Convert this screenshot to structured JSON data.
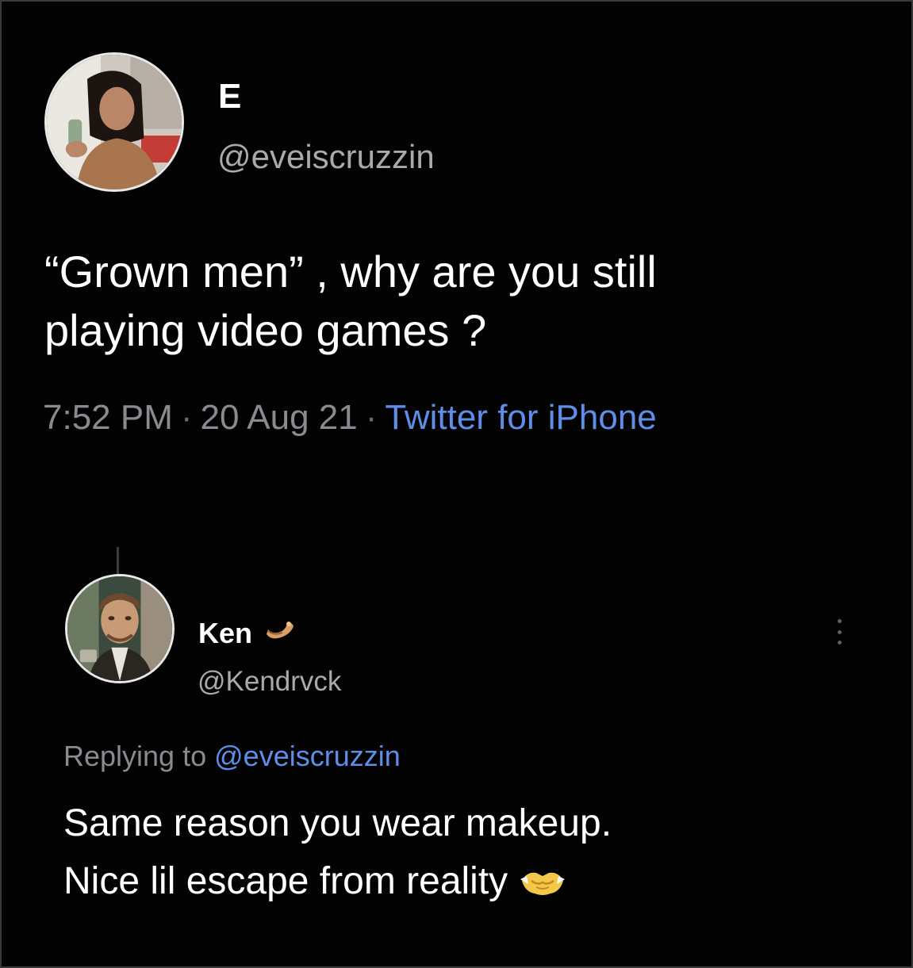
{
  "tweet": {
    "author_name": "E",
    "author_handle": "@eveiscruzzin",
    "text": "“Grown men” , why are you still\nplaying video games ?",
    "time": "7:52 PM",
    "date": "20 Aug 21",
    "source": "Twitter for iPhone",
    "separator": "·"
  },
  "reply": {
    "author_name": "Ken",
    "author_handle": "@Kendrvck",
    "replying_prefix": "Replying to",
    "replying_mention": "@eveiscruzzin",
    "text_line_1": "Same reason you wear makeup.",
    "text_line_2": "Nice lil escape from reality",
    "name_badge_icon": "emoji-badge-icon",
    "trailing_emoji_icon": "handshake-emoji-icon"
  },
  "colors": {
    "background": "#030303",
    "primary_text": "#ffffff",
    "secondary_text": "#8a8a90",
    "link": "#5f8ee8"
  }
}
